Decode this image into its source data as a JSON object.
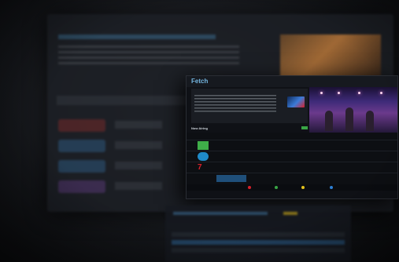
{
  "colors": {
    "background": "#15171b",
    "accent_blue": "#74b6e0",
    "highlight_blue": "#1f4f7a",
    "green": "#39a545",
    "red": "#d8202a",
    "yellow": "#e3c21c",
    "legend_blue": "#2d7fd3"
  },
  "front_screen": {
    "logo": "Fetch",
    "top_right": "",
    "now_section_label": "Now Airing",
    "grid_headers": [
      "",
      "",
      "",
      "",
      "",
      "",
      ""
    ],
    "channels": [
      {
        "icon": "channel-logo-green-icon",
        "color": "#3fae49"
      },
      {
        "icon": "channel-logo-abc-icon",
        "color": "#1f8ac8"
      },
      {
        "icon": "channel-logo-seven-icon",
        "color": "#d8202a"
      }
    ],
    "legend": [
      {
        "color": "#d8202a",
        "label": ""
      },
      {
        "color": "#39a545",
        "label": ""
      },
      {
        "color": "#e3c21c",
        "label": ""
      },
      {
        "color": "#2d7fd3",
        "label": ""
      }
    ]
  }
}
